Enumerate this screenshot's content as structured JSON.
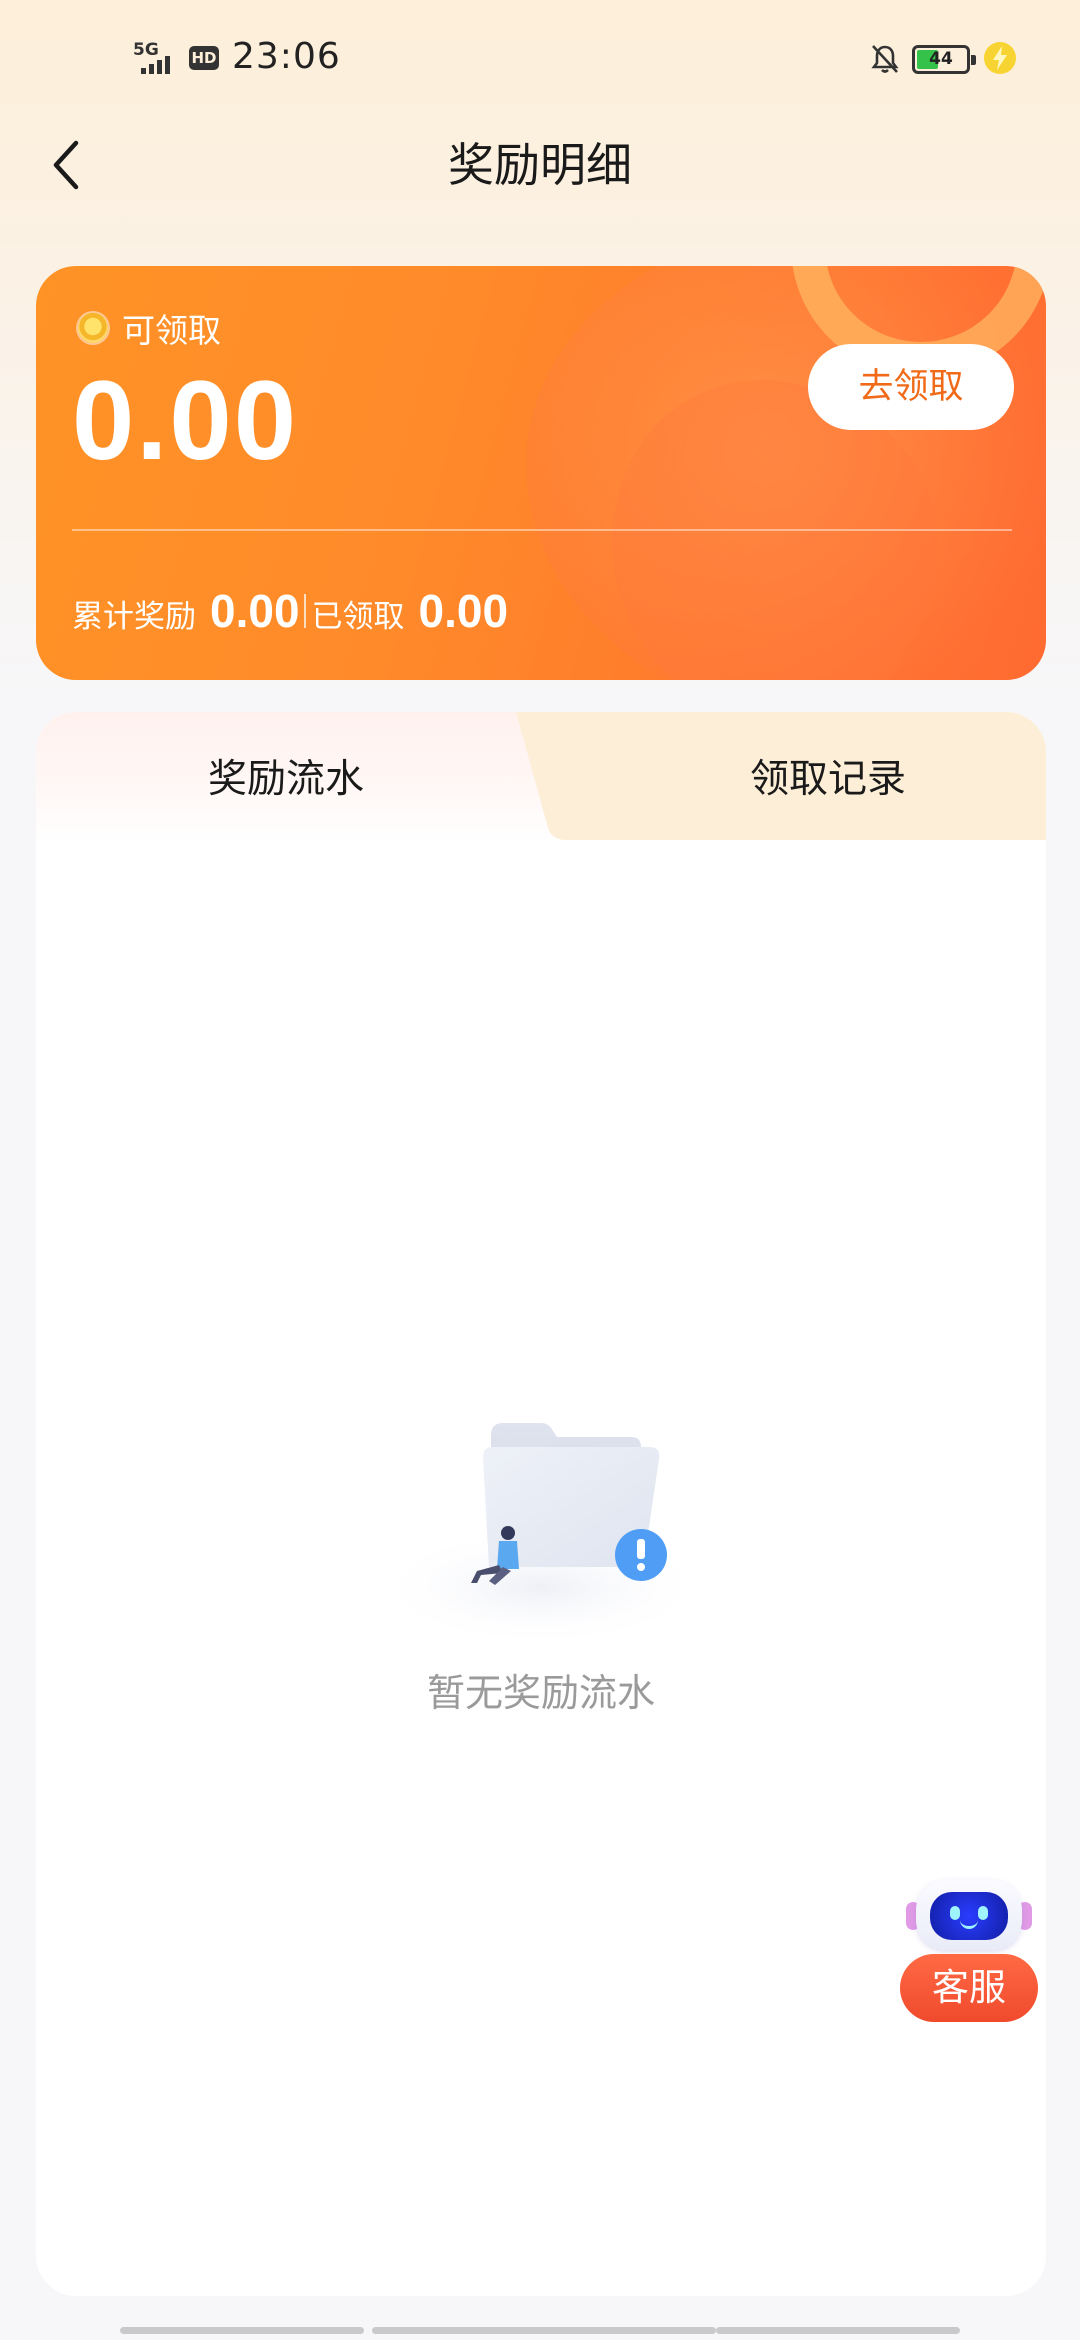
{
  "status_bar": {
    "network": "5G",
    "hd": "HD",
    "time": "23:06",
    "battery_level": "44",
    "battery_fraction": 0.44
  },
  "header": {
    "title": "奖励明细"
  },
  "reward_card": {
    "claimable_label": "可领取",
    "claimable_amount": "0.00",
    "claim_button": "去领取",
    "total_label": "累计奖励",
    "total_value": "0.00",
    "claimed_label": "已领取",
    "claimed_value": "0.00"
  },
  "tabs": [
    {
      "label": "奖励流水",
      "active": true
    },
    {
      "label": "领取记录",
      "active": false
    }
  ],
  "empty_state": {
    "text": "暂无奖励流水"
  },
  "service": {
    "label": "客服"
  },
  "colors": {
    "card_orange": "#ff7a2c",
    "claim_text": "#f06a18",
    "tab_inactive_bg": "#fdefd7",
    "service_red": "#f04a2c",
    "battery_green": "#35c24a"
  }
}
